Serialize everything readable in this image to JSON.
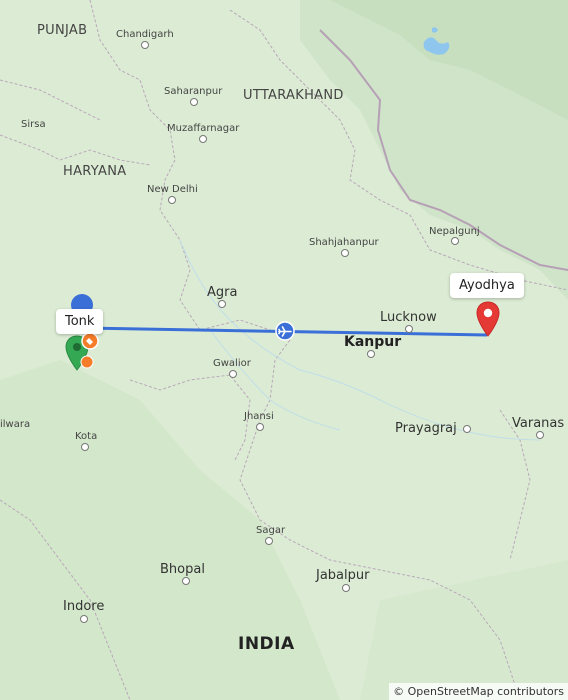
{
  "map": {
    "regions": {
      "punjab": "PUNJAB",
      "haryana": "HARYANA",
      "uttarakhand": "UTTARAKHAND"
    },
    "country": "INDIA",
    "cities": {
      "chandigarh": "Chandigarh",
      "saharanpur": "Saharanpur",
      "muzaffarnagar": "Muzaffarnagar",
      "sirsa": "Sirsa",
      "new_delhi": "New Delhi",
      "shahjahanpur": "Shahjahanpur",
      "nepalgunj": "Nepalgunj",
      "agra": "Agra",
      "lucknow": "Lucknow",
      "kanpur": "Kanpur",
      "gwalior": "Gwalior",
      "bhilwara": "ilwara",
      "kota": "Kota",
      "jhansi": "Jhansi",
      "prayagraj": "Prayagraj",
      "varanasi": "Varanas",
      "sagar": "Sagar",
      "bhopal": "Bhopal",
      "jabalpur": "Jabalpur",
      "indore": "Indore"
    },
    "route": {
      "origin_label": "Tonk",
      "destination_label": "Ayodhya",
      "mode_icon": "airplane-icon",
      "line_color": "#3b6fd8",
      "destination_pin_color": "#e53935",
      "origin_marker_color": "#3b6fd8"
    },
    "extra_markers": {
      "green_pin_color": "#34a853",
      "orange_badge_color": "#f57c28"
    },
    "attribution": "© OpenStreetMap contributors"
  }
}
